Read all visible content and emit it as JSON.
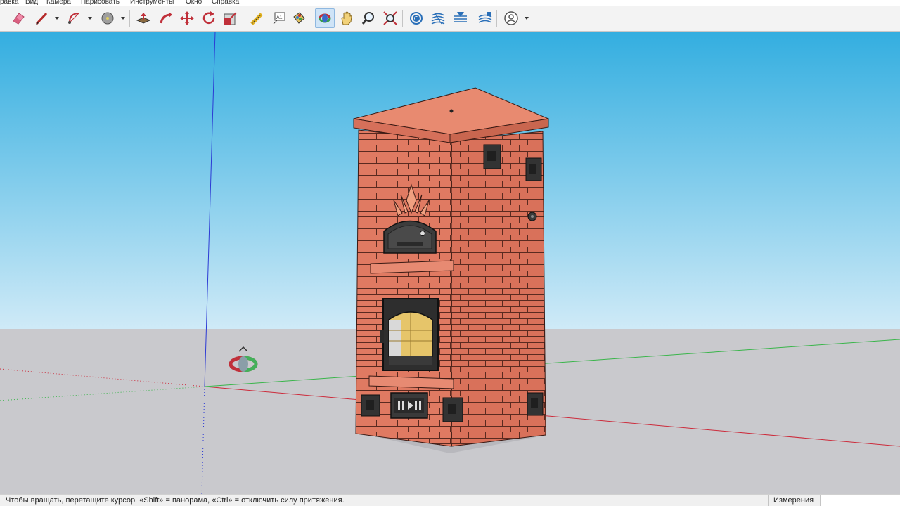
{
  "menu": {
    "items": [
      "равка",
      "Вид",
      "Камера",
      "Нарисовать",
      "Инструменты",
      "Окно",
      "Справка"
    ]
  },
  "toolbar": {
    "tools": [
      {
        "name": "eraser-icon"
      },
      {
        "name": "pencil-icon"
      },
      {
        "name": "arc-icon"
      },
      {
        "name": "circle-icon"
      },
      {
        "name": "push-pull-icon"
      },
      {
        "name": "follow-me-icon"
      },
      {
        "name": "move-icon"
      },
      {
        "name": "rotate-icon"
      },
      {
        "name": "scale-icon"
      },
      {
        "name": "tape-measure-icon"
      },
      {
        "name": "text-icon"
      },
      {
        "name": "paint-bucket-icon"
      },
      {
        "name": "orbit-icon",
        "active": true
      },
      {
        "name": "pan-icon"
      },
      {
        "name": "zoom-icon"
      },
      {
        "name": "zoom-extents-icon"
      },
      {
        "name": "sandbox-from-contours-icon"
      },
      {
        "name": "sandbox-from-scratch-icon"
      },
      {
        "name": "sandbox-smoove-icon"
      },
      {
        "name": "sandbox-stamp-icon"
      },
      {
        "name": "account-icon"
      }
    ]
  },
  "colors": {
    "sky_top": "#33b0e0",
    "sky_bottom": "#d0ecf8",
    "ground": "#c9c9cd",
    "brick": "#e07a62",
    "brick_top": "#e88a70",
    "mortar": "#5a2a20",
    "iron": "#3a3a3a",
    "axis_red": "#cc2b3b",
    "axis_green": "#39b54a",
    "axis_blue": "#2c3ad4",
    "active_tool": "#cfe4f7"
  },
  "status": {
    "hint": "Чтобы вращать, перетащите курсор. «Shift» = панорама, «Ctrl» = отключить силу притяжения.",
    "measurements_label": "Измерения",
    "measurements_value": ""
  }
}
